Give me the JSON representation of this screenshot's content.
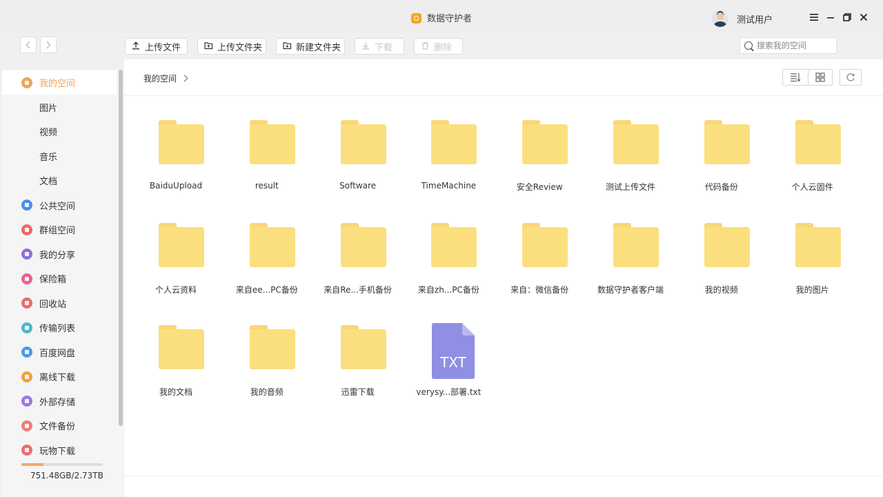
{
  "window": {
    "title": "数据守护者"
  },
  "user": {
    "name": "测试用户"
  },
  "toolbar": {
    "upload_file": "上传文件",
    "upload_folder": "上传文件夹",
    "new_folder": "新建文件夹",
    "download": "下载",
    "delete": "删除"
  },
  "search": {
    "placeholder": "搜索我的空间",
    "value": ""
  },
  "sidebar": {
    "items": [
      {
        "label": "我的空间",
        "icon": "user-space-icon",
        "color": "#e8a55a",
        "active": true
      },
      {
        "label": "图片",
        "sub": true
      },
      {
        "label": "视频",
        "sub": true
      },
      {
        "label": "音乐",
        "sub": true
      },
      {
        "label": "文档",
        "sub": true
      },
      {
        "label": "公共空间",
        "icon": "public-space-icon",
        "color": "#4a8fe7"
      },
      {
        "label": "群组空间",
        "icon": "group-space-icon",
        "color": "#e96a6a"
      },
      {
        "label": "我的分享",
        "icon": "share-icon",
        "color": "#8e6fdc"
      },
      {
        "label": "保险箱",
        "icon": "safe-box-icon",
        "color": "#e9628a"
      },
      {
        "label": "回收站",
        "icon": "trash-icon",
        "color": "#e86d6d"
      },
      {
        "label": "传输列表",
        "icon": "transfer-icon",
        "color": "#4db8c8"
      },
      {
        "label": "百度网盘",
        "icon": "baidu-netdisk-icon",
        "color": "#4b9ae8"
      },
      {
        "label": "离线下载",
        "icon": "offline-download-icon",
        "color": "#f0a142"
      },
      {
        "label": "外部存储",
        "icon": "external-storage-icon",
        "color": "#9a7ae0"
      },
      {
        "label": "文件备份",
        "icon": "file-backup-icon",
        "color": "#ee7d7d"
      },
      {
        "label": "玩物下载",
        "icon": "wanwu-download-icon",
        "color": "#ef6d6d"
      }
    ],
    "storage": {
      "text": "751.48GB/2.73TB",
      "used_fraction": 0.27
    }
  },
  "breadcrumb": {
    "root": "我的空间"
  },
  "files": [
    {
      "name": "BaiduUpload",
      "type": "folder"
    },
    {
      "name": "result",
      "type": "folder"
    },
    {
      "name": "Software",
      "type": "folder"
    },
    {
      "name": "TimeMachine",
      "type": "folder"
    },
    {
      "name": "安全Review",
      "type": "folder"
    },
    {
      "name": "测试上传文件",
      "type": "folder"
    },
    {
      "name": "代码备份",
      "type": "folder"
    },
    {
      "name": "个人云固件",
      "type": "folder"
    },
    {
      "name": "个人云资料",
      "type": "folder"
    },
    {
      "name": "来自ee...PC备份",
      "type": "folder"
    },
    {
      "name": "来自Re...手机备份",
      "type": "folder"
    },
    {
      "name": "来自zh...PC备份",
      "type": "folder"
    },
    {
      "name": "来自：微信备份",
      "type": "folder"
    },
    {
      "name": "数据守护者客户端",
      "type": "folder"
    },
    {
      "name": "我的视频",
      "type": "folder"
    },
    {
      "name": "我的图片",
      "type": "folder"
    },
    {
      "name": "我的文档",
      "type": "folder"
    },
    {
      "name": "我的音频",
      "type": "folder"
    },
    {
      "name": "迅雷下载",
      "type": "folder"
    },
    {
      "name": "verysy...部署.txt",
      "type": "txt",
      "badge": "TXT"
    }
  ]
}
